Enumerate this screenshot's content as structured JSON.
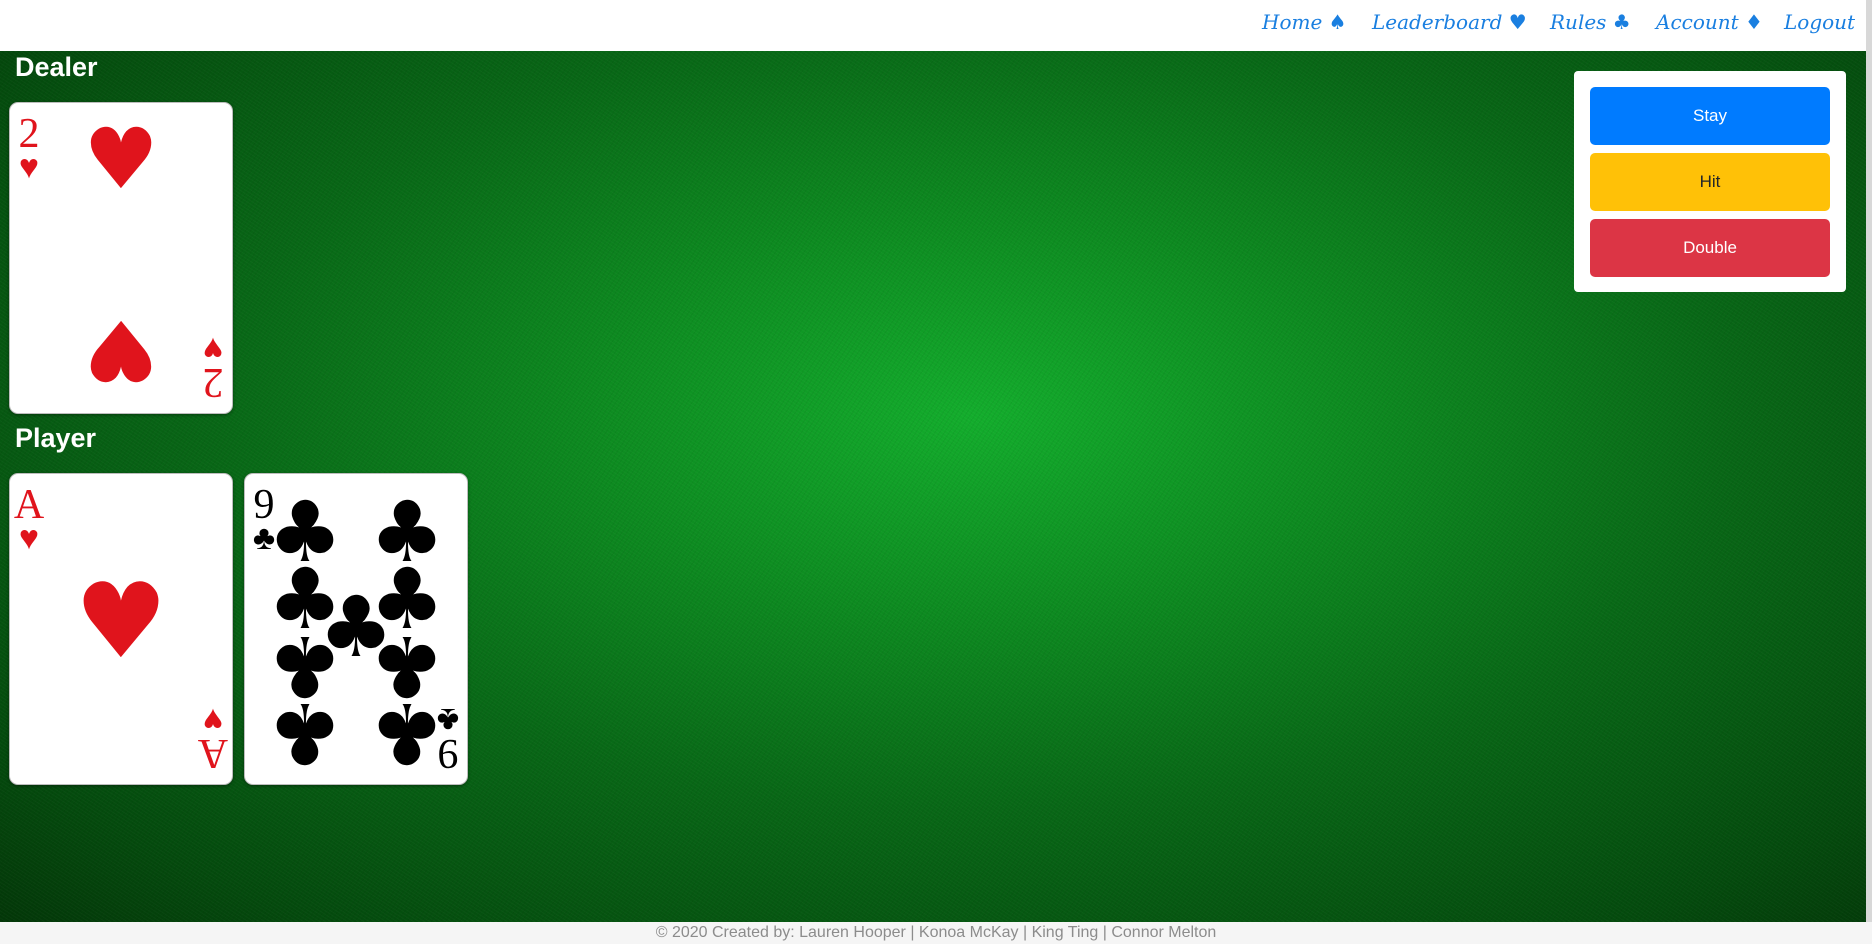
{
  "nav": {
    "items": [
      {
        "label": "Home",
        "icon": "♠"
      },
      {
        "label": "Leaderboard",
        "icon": "♥"
      },
      {
        "label": "Rules",
        "icon": "♣"
      },
      {
        "label": "Account",
        "icon": "♦"
      },
      {
        "label": "Logout",
        "icon": ""
      }
    ]
  },
  "dealer": {
    "label": "Dealer",
    "cards": [
      {
        "rank": "2",
        "suit": "♥",
        "color": "#e0141c"
      }
    ]
  },
  "player": {
    "label": "Player",
    "cards": [
      {
        "rank": "A",
        "suit": "♥",
        "color": "#e0141c"
      },
      {
        "rank": "9",
        "suit": "♣",
        "color": "#000000"
      }
    ]
  },
  "actions": {
    "stay": {
      "label": "Stay",
      "color": "#007bff"
    },
    "hit": {
      "label": "Hit",
      "color": "#ffc107"
    },
    "double": {
      "label": "Double",
      "color": "#dc3545"
    }
  },
  "footer": {
    "text": "© 2020 Created by: Lauren Hooper | Konoa McKay | King Ting | Connor Melton"
  }
}
